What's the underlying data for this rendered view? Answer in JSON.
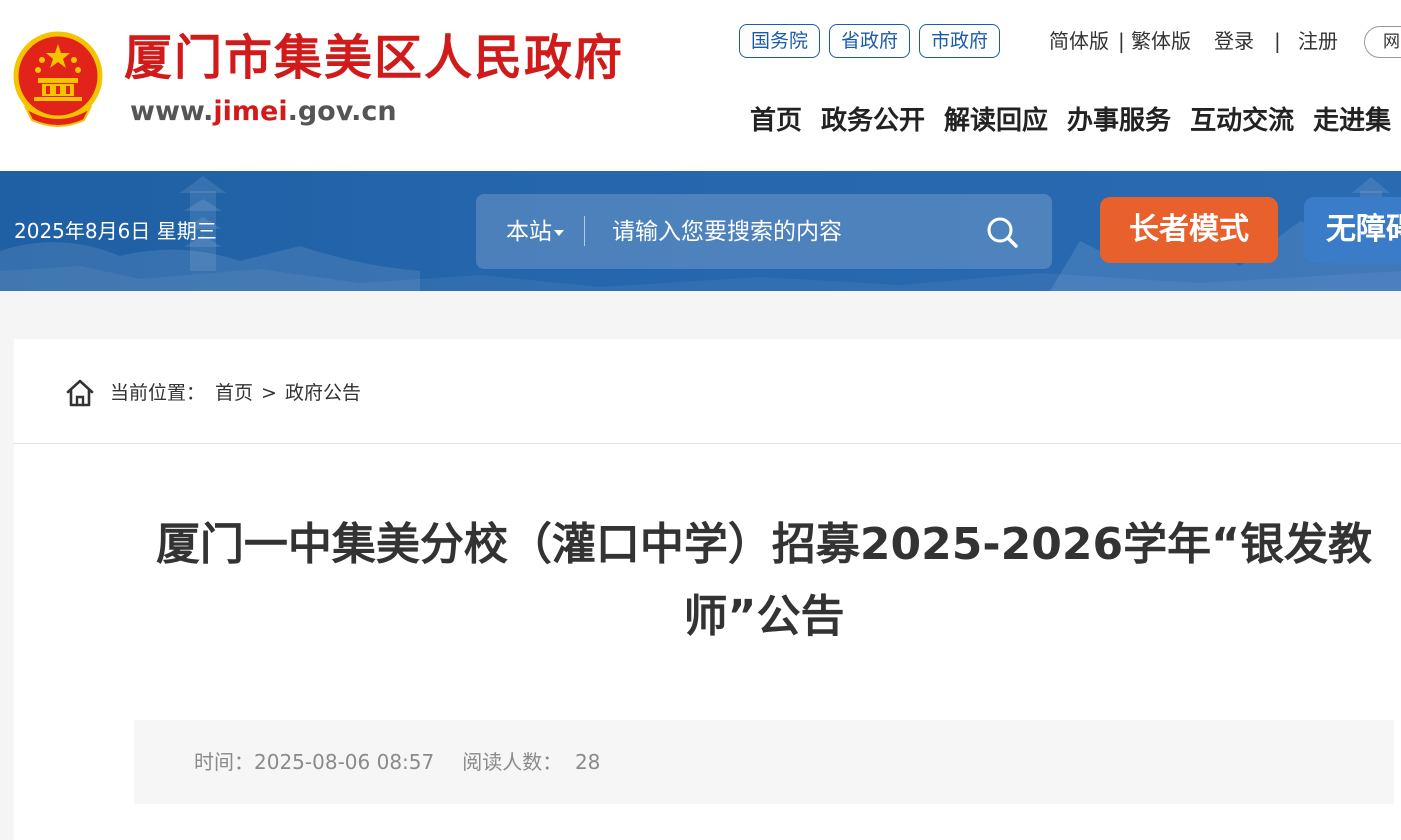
{
  "header": {
    "site_title": "厦门市集美区人民政府",
    "url_prefix": "www.",
    "url_highlight": "jimei",
    "url_suffix": ".gov.cn",
    "gov_links": [
      "国务院",
      "省政府",
      "市政府"
    ],
    "simplified": "简体版",
    "lang_sep": "|",
    "traditional": "繁体版",
    "login": "登录",
    "auth_sep": "|",
    "register": "注册",
    "web_button": "网",
    "nav": [
      "首页",
      "政务公开",
      "解读回应",
      "办事服务",
      "互动交流",
      "走进集"
    ]
  },
  "banner": {
    "date": "2025年8月6日 星期三",
    "search_scope": "本站",
    "search_placeholder": "请输入您要搜索的内容",
    "elder_mode": "长者模式",
    "accessibility": "无障碍"
  },
  "breadcrumb": {
    "label": "当前位置：",
    "home": "首页",
    "separator": ">",
    "current": "政府公告"
  },
  "article": {
    "title": "厦门一中集美分校（灌口中学）招募2025-2026学年“银发教师”公告",
    "time_label": "时间：",
    "time_value": "2025-08-06 08:57",
    "views_label": "阅读人数：",
    "views_value": "28"
  },
  "colors": {
    "brand_red": "#d11a1a",
    "link_blue": "#1a5bab",
    "banner_blue": "#2566ad",
    "elder_orange": "#e8602c"
  }
}
